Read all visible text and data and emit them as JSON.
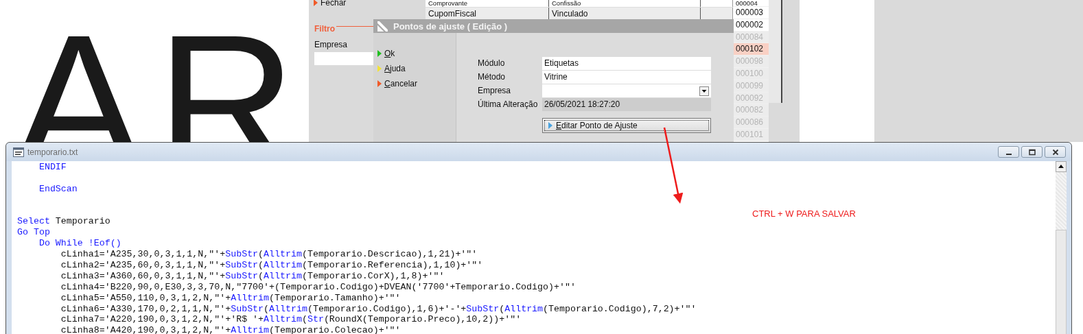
{
  "backdrop_text": "AR",
  "background_window": {
    "actions": [
      {
        "label": "Fechar",
        "color": "#f05a28"
      }
    ],
    "filter": {
      "heading": "Filtro",
      "field_label": "Empresa"
    },
    "table": {
      "rows": [
        {
          "cells": [
            "Comprovante",
            "Confissão"
          ]
        },
        {
          "cells": [
            "CupomFiscal",
            "Vinculado"
          ]
        }
      ]
    },
    "codes": [
      {
        "code": "000004",
        "selected": false,
        "disabled": false
      },
      {
        "code": "000003",
        "selected": false,
        "disabled": false
      },
      {
        "code": "000002",
        "selected": false,
        "disabled": false
      },
      {
        "code": "000084",
        "selected": false,
        "disabled": true
      },
      {
        "code": "000102",
        "selected": true,
        "disabled": false
      },
      {
        "code": "000098",
        "selected": false,
        "disabled": true
      },
      {
        "code": "000100",
        "selected": false,
        "disabled": true
      },
      {
        "code": "000099",
        "selected": false,
        "disabled": true
      },
      {
        "code": "000092",
        "selected": false,
        "disabled": true
      },
      {
        "code": "000082",
        "selected": false,
        "disabled": true
      },
      {
        "code": "000086",
        "selected": false,
        "disabled": true
      },
      {
        "code": "000101",
        "selected": false,
        "disabled": true
      }
    ]
  },
  "dialog": {
    "title": "Pontos de ajuste ( Edição )",
    "actions": [
      {
        "label": "Ok",
        "color": "#1fbf1f"
      },
      {
        "label": "Ajuda",
        "color": "#f2e23a"
      },
      {
        "label": "Cancelar",
        "color": "#f05a28"
      }
    ],
    "fields": [
      {
        "label": "Módulo",
        "value": "Etiquetas",
        "kind": "text"
      },
      {
        "label": "Método",
        "value": "Vitrine",
        "kind": "text"
      },
      {
        "label": "Empresa",
        "kind": "dropdown"
      },
      {
        "label": "Última Alteração",
        "value": "26/05/2021 18:27:20",
        "kind": "readonly"
      }
    ],
    "button": "Editar Ponto de Ajuste"
  },
  "annotation": {
    "text": "CTRL + W PARA SALVAR"
  },
  "editor": {
    "title": "temporario.txt",
    "lines": [
      {
        "kind": "code",
        "segments": [
          {
            "text": "    ENDIF",
            "kind": "keyword"
          }
        ]
      },
      {
        "kind": "blank"
      },
      {
        "kind": "code",
        "segments": [
          {
            "text": "    EndScan",
            "kind": "keyword"
          }
        ]
      },
      {
        "kind": "blank"
      },
      {
        "kind": "blank"
      },
      {
        "kind": "code",
        "segments": [
          {
            "text": "Select",
            "kind": "keyword"
          },
          {
            "text": " Temporario",
            "kind": "plain"
          }
        ]
      },
      {
        "kind": "code",
        "segments": [
          {
            "text": "Go Top",
            "kind": "keyword"
          }
        ]
      },
      {
        "kind": "code",
        "segments": [
          {
            "text": "    Do While !Eof()",
            "kind": "keyword"
          }
        ]
      },
      {
        "kind": "code",
        "segments": [
          {
            "text": "        cLinha1='A235,30,0,3,1,1,N,\"'+",
            "kind": "plain"
          },
          {
            "text": "SubStr",
            "kind": "keyword"
          },
          {
            "text": "(",
            "kind": "plain"
          },
          {
            "text": "Alltrim",
            "kind": "keyword"
          },
          {
            "text": "(Temporario.Descricao),1,21)+'\"'",
            "kind": "plain"
          }
        ]
      },
      {
        "kind": "code",
        "segments": [
          {
            "text": "        cLinha2='A235,60,0,3,1,1,N,\"'+",
            "kind": "plain"
          },
          {
            "text": "SubStr",
            "kind": "keyword"
          },
          {
            "text": "(",
            "kind": "plain"
          },
          {
            "text": "Alltrim",
            "kind": "keyword"
          },
          {
            "text": "(Temporario.Referencia),1,10)+'\"'",
            "kind": "plain"
          }
        ]
      },
      {
        "kind": "code",
        "segments": [
          {
            "text": "        cLinha3='A360,60,0,3,1,1,N,\"'+",
            "kind": "plain"
          },
          {
            "text": "SubStr",
            "kind": "keyword"
          },
          {
            "text": "(",
            "kind": "plain"
          },
          {
            "text": "Alltrim",
            "kind": "keyword"
          },
          {
            "text": "(Temporario.CorX),1,8)+'\"'",
            "kind": "plain"
          }
        ]
      },
      {
        "kind": "code",
        "segments": [
          {
            "text": "        cLinha4='B220,90,0,E30,3,3,70,N,\"7700'+(Temporario.Codigo)+DVEAN('7700'+Temporario.Codigo)+'\"'",
            "kind": "plain"
          }
        ]
      },
      {
        "kind": "code",
        "segments": [
          {
            "text": "        cLinha5='A550,110,0,3,1,2,N,\"'+",
            "kind": "plain"
          },
          {
            "text": "Alltrim",
            "kind": "keyword"
          },
          {
            "text": "(Temporario.Tamanho)+'\"'",
            "kind": "plain"
          }
        ]
      },
      {
        "kind": "code",
        "segments": [
          {
            "text": "        cLinha6='A330,170,0,2,1,1,N,\"'+",
            "kind": "plain"
          },
          {
            "text": "SubStr",
            "kind": "keyword"
          },
          {
            "text": "(",
            "kind": "plain"
          },
          {
            "text": "Alltrim",
            "kind": "keyword"
          },
          {
            "text": "(Temporario.Codigo),1,6)+'-'+",
            "kind": "plain"
          },
          {
            "text": "SubStr",
            "kind": "keyword"
          },
          {
            "text": "(",
            "kind": "plain"
          },
          {
            "text": "Alltrim",
            "kind": "keyword"
          },
          {
            "text": "(Temporario.Codigo),7,2)+'\"'",
            "kind": "plain"
          }
        ]
      },
      {
        "kind": "code",
        "segments": [
          {
            "text": "        cLinha7='A220,190,0,3,1,2,N,\"'+'R$ '+",
            "kind": "plain"
          },
          {
            "text": "Alltrim",
            "kind": "keyword"
          },
          {
            "text": "(",
            "kind": "plain"
          },
          {
            "text": "Str",
            "kind": "keyword"
          },
          {
            "text": "(RoundX(Temporario.Preco),10,2))+'\"'",
            "kind": "plain"
          }
        ]
      },
      {
        "kind": "code",
        "segments": [
          {
            "text": "        cLinha8='A420,190,0,3,1,2,N,\"'+",
            "kind": "plain"
          },
          {
            "text": "Alltrim",
            "kind": "keyword"
          },
          {
            "text": "(Temporario.Colecao)+'\"'",
            "kind": "plain"
          }
        ]
      }
    ]
  }
}
